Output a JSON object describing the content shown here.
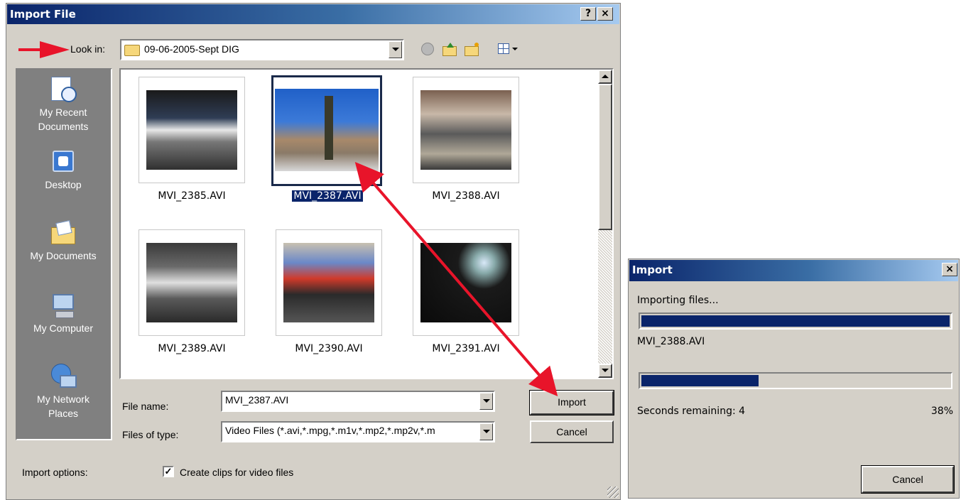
{
  "import_dialog": {
    "title": "Import File",
    "help_button": "?",
    "close_button": "×",
    "look_in_label": "Look in:",
    "look_in_value": "09-06-2005-Sept DIG",
    "places": [
      {
        "label": "My Recent Documents"
      },
      {
        "label": "Desktop"
      },
      {
        "label": "My Documents"
      },
      {
        "label": "My Computer"
      },
      {
        "label": "My Network Places"
      }
    ],
    "files": [
      {
        "name": "MVI_2385.AVI"
      },
      {
        "name": "MVI_2387.AVI"
      },
      {
        "name": "MVI_2388.AVI"
      },
      {
        "name": "MVI_2389.AVI"
      },
      {
        "name": "MVI_2390.AVI"
      },
      {
        "name": "MVI_2391.AVI"
      }
    ],
    "selected_file": "MVI_2387.AVI",
    "file_name_label": "File name:",
    "file_name_value": "MVI_2387.AVI",
    "files_of_type_label": "Files of type:",
    "files_of_type_value": "Video Files (*.avi,*.mpg,*.m1v,*.mp2,*.mp2v,*.m",
    "import_button": "Import",
    "cancel_button": "Cancel",
    "import_options_label": "Import options:",
    "create_clips_label": "Create clips for video files",
    "create_clips_checked": true
  },
  "progress_dialog": {
    "title": "Import",
    "close_button": "×",
    "status": "Importing files...",
    "overall_progress_pct": 100,
    "current_file": "MVI_2388.AVI",
    "file_progress_pct": 38,
    "seconds_remaining": "Seconds remaining: 4",
    "percent_text": "38%",
    "cancel_button": "Cancel"
  },
  "colors": {
    "dialog_bg": "#d4d0c8",
    "title_bar": "#0a246a",
    "places_bar": "#808080",
    "progress_fill": "#0a246a",
    "annotation_arrow": "#e8142a"
  }
}
